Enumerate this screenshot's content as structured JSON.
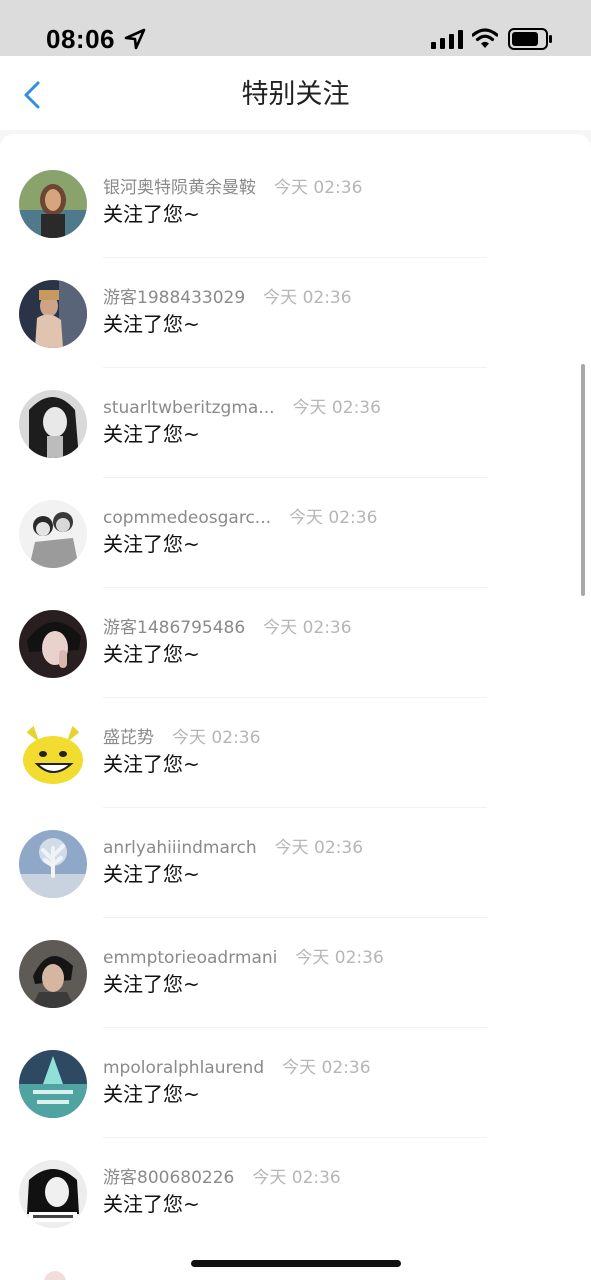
{
  "status_bar": {
    "time": "08:06",
    "icons": [
      "location-arrow-icon",
      "cellular-signal-icon",
      "wifi-icon",
      "battery-icon"
    ]
  },
  "nav": {
    "back_icon": "chevron-left-icon",
    "title": "特别关注"
  },
  "colors": {
    "accent": "#2f8de4",
    "name_gray": "#8a8a8a",
    "time_gray": "#b6b6b6",
    "text": "#111111",
    "status_bg": "#dcdcdc"
  },
  "items": [
    {
      "name": "银河奥特陨黄余曼鞍",
      "time": "今天 02:36",
      "action": "关注了您~"
    },
    {
      "name": "游客1988433029",
      "time": "今天 02:36",
      "action": "关注了您~"
    },
    {
      "name": "stuarltwberitzgma...",
      "time": "今天 02:36",
      "action": "关注了您~"
    },
    {
      "name": "copmmedeosgarc...",
      "time": "今天 02:36",
      "action": "关注了您~"
    },
    {
      "name": "游客1486795486",
      "time": "今天 02:36",
      "action": "关注了您~"
    },
    {
      "name": "盛芘势",
      "time": "今天 02:36",
      "action": "关注了您~"
    },
    {
      "name": "anrlyahiiindmarch",
      "time": "今天 02:36",
      "action": "关注了您~"
    },
    {
      "name": "emmptorieoadrmani",
      "time": "今天 02:36",
      "action": "关注了您~"
    },
    {
      "name": "mpoloralphlaurend",
      "time": "今天 02:36",
      "action": "关注了您~"
    },
    {
      "name": "游客800680226",
      "time": "今天 02:36",
      "action": "关注了您~"
    }
  ]
}
